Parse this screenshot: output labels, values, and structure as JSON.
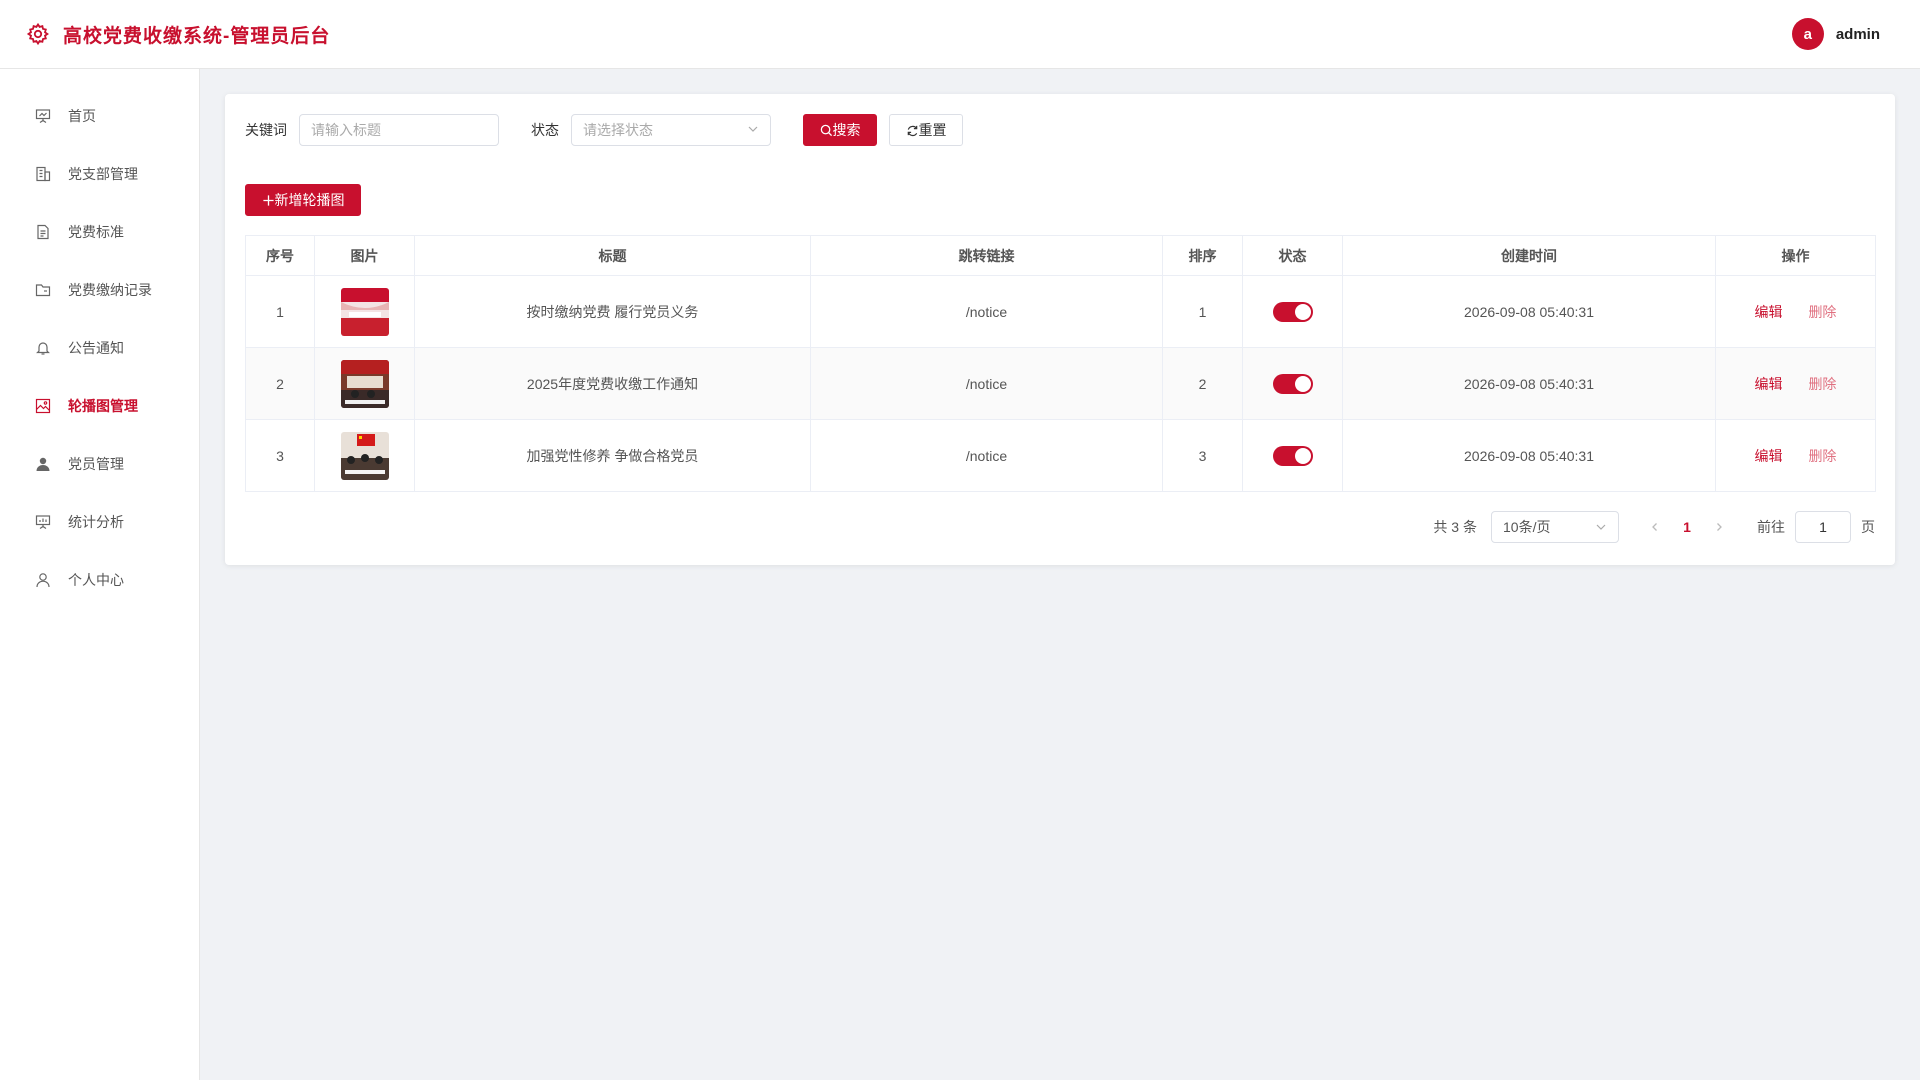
{
  "header": {
    "title": "高校党费收缴系统-管理员后台",
    "avatar_letter": "a",
    "username": "admin"
  },
  "sidebar": {
    "items": [
      {
        "label": "首页",
        "icon": "presentation-icon"
      },
      {
        "label": "党支部管理",
        "icon": "building-icon"
      },
      {
        "label": "党费标准",
        "icon": "document-icon"
      },
      {
        "label": "党费缴纳记录",
        "icon": "folder-icon"
      },
      {
        "label": "公告通知",
        "icon": "bell-icon"
      },
      {
        "label": "轮播图管理",
        "icon": "picture-icon",
        "active": true
      },
      {
        "label": "党员管理",
        "icon": "user-filled-icon"
      },
      {
        "label": "统计分析",
        "icon": "chart-board-icon"
      },
      {
        "label": "个人中心",
        "icon": "user-icon"
      }
    ]
  },
  "filters": {
    "keyword_label": "关键词",
    "keyword_placeholder": "请输入标题",
    "status_label": "状态",
    "status_placeholder": "请选择状态",
    "search_label": "搜索",
    "reset_label": "重置"
  },
  "toolbar": {
    "add_label": "新增轮播图"
  },
  "table": {
    "columns": [
      "序号",
      "图片",
      "标题",
      "跳转链接",
      "排序",
      "状态",
      "创建时间",
      "操作"
    ],
    "rows": [
      {
        "index": "1",
        "title": "按时缴纳党费 履行党员义务",
        "link": "/notice",
        "sort": "1",
        "status": true,
        "created": "2026-09-08 05:40:31",
        "edit": "编辑",
        "delete": "删除"
      },
      {
        "index": "2",
        "title": "2025年度党费收缴工作通知",
        "link": "/notice",
        "sort": "2",
        "status": true,
        "created": "2026-09-08 05:40:31",
        "edit": "编辑",
        "delete": "删除"
      },
      {
        "index": "3",
        "title": "加强党性修养 争做合格党员",
        "link": "/notice",
        "sort": "3",
        "status": true,
        "created": "2026-09-08 05:40:31",
        "edit": "编辑",
        "delete": "删除"
      }
    ]
  },
  "pagination": {
    "total_text": "共 3 条",
    "page_size": "10条/页",
    "current_page": "1",
    "goto_label": "前往",
    "goto_value": "1",
    "page_suffix": "页"
  },
  "colors": {
    "brand": "#c8102e"
  }
}
